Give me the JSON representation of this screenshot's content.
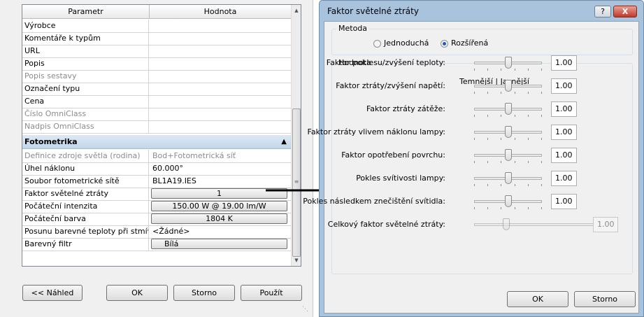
{
  "type_properties": {
    "columns": {
      "parameter": "Parametr",
      "value": "Hodnota"
    },
    "rows_top": [
      {
        "name": "Výrobce",
        "value": ""
      },
      {
        "name": "Komentáře k typům",
        "value": ""
      },
      {
        "name": "URL",
        "value": ""
      },
      {
        "name": "Popis",
        "value": ""
      },
      {
        "name": "Popis sestavy",
        "value": ""
      },
      {
        "name": "Označení typu",
        "value": ""
      },
      {
        "name": "Cena",
        "value": ""
      },
      {
        "name": "Číslo OmniClass",
        "value": ""
      },
      {
        "name": "Nadpis OmniClass",
        "value": ""
      }
    ],
    "group": {
      "label": "Fotometrika",
      "collapse_icon": "double-chevron-up-icon"
    },
    "rows_group": [
      {
        "name": "Definice zdroje světla (rodina)",
        "value": "Bod+Fotometrická síť"
      },
      {
        "name": "Úhel náklonu",
        "value": "60.000°"
      },
      {
        "name": "Soubor fotometrické sítě",
        "value": "BL1A19.IES"
      },
      {
        "name": "Faktor světelné ztráty",
        "value": "1"
      },
      {
        "name": "Počáteční intenzita",
        "value": "150.00 W @ 19.00 lm/W"
      },
      {
        "name": "Počáteční barva",
        "value": "1804 K"
      },
      {
        "name": "Posunu barevné teploty při stmív",
        "value": "<Žádné>"
      },
      {
        "name": "Barevný filtr",
        "value": "Bílá"
      }
    ],
    "buttons": {
      "preview": "<< Náhled",
      "ok": "OK",
      "cancel": "Storno",
      "apply": "Použít"
    }
  },
  "loss_factor_dialog": {
    "title": "Faktor světelné ztráty",
    "help_label": "?",
    "close_label": "X",
    "method": {
      "label": "Metoda",
      "simple_label": "Jednoduchá",
      "advanced_label": "Rozšířená",
      "selected": "Rozšířená"
    },
    "value_group": {
      "label": "Hodnota",
      "scale_label": "Temnější | Jasnější",
      "factors": [
        {
          "name": "Faktor poklesu/zvýšení teploty:",
          "value": "1.00",
          "level": 0.5,
          "enabled": true
        },
        {
          "name": "Faktor ztráty/zvýšení napětí:",
          "value": "1.00",
          "level": 0.5,
          "enabled": true
        },
        {
          "name": "Faktor ztráty zátěže:",
          "value": "1.00",
          "level": 0.5,
          "enabled": true
        },
        {
          "name": "Faktor ztráty vlivem náklonu lampy:",
          "value": "1.00",
          "level": 0.5,
          "enabled": true
        },
        {
          "name": "Faktor opotřebení povrchu:",
          "value": "1.00",
          "level": 0.5,
          "enabled": true
        },
        {
          "name": "Pokles svítivosti lampy:",
          "value": "1.00",
          "level": 0.5,
          "enabled": true
        },
        {
          "name": "Pokles následkem znečištění svítidla:",
          "value": "1.00",
          "level": 0.5,
          "enabled": true
        },
        {
          "name": "Celkový faktor světelné ztráty:",
          "value": "1.00",
          "level": 0.25,
          "enabled": false
        }
      ]
    },
    "buttons": {
      "ok": "OK",
      "cancel": "Storno"
    }
  },
  "colors": {
    "group_header": "#c4d6eb",
    "title_bar": "#a9c3dd",
    "close_button": "#c0392b",
    "arrow": "#000000"
  }
}
